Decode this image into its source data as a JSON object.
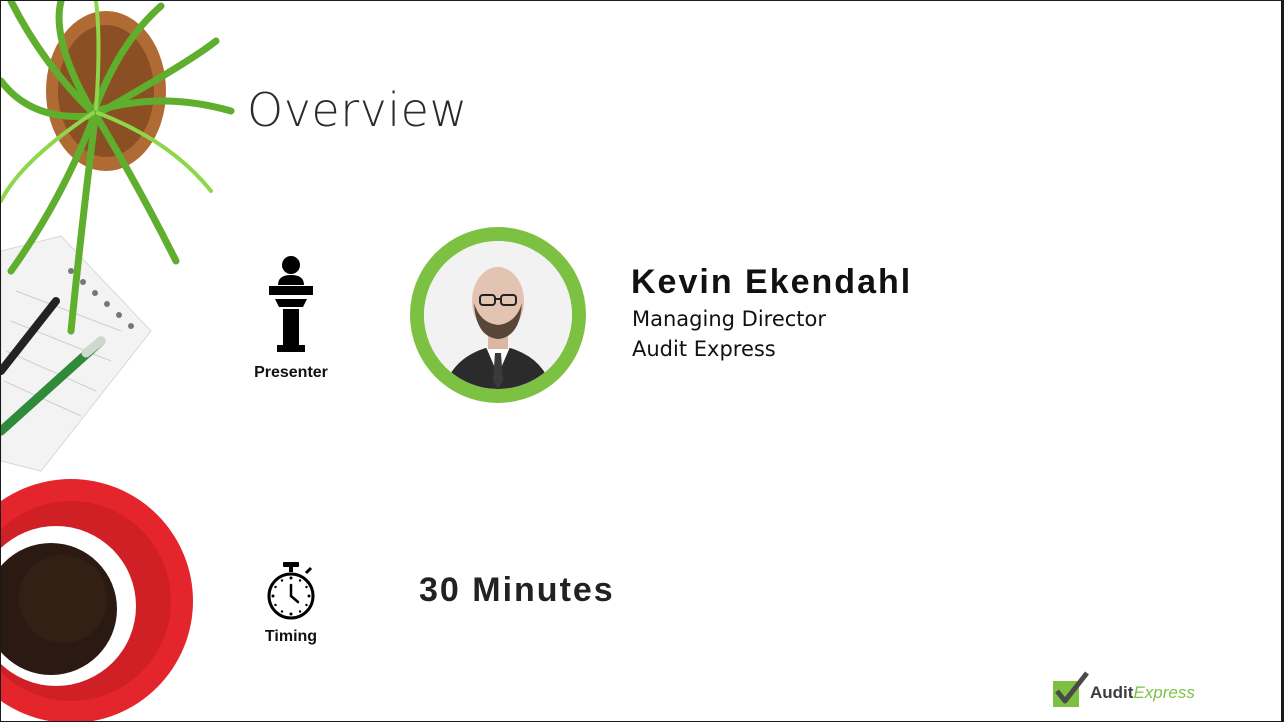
{
  "slide": {
    "title": "Overview"
  },
  "presenter": {
    "icon": "podium-icon",
    "icon_label": "Presenter",
    "name": "Kevin Ekendahl",
    "role": "Managing Director",
    "company": "Audit Express"
  },
  "timing": {
    "icon": "stopwatch-icon",
    "icon_label": "Timing",
    "duration": "30 Minutes"
  },
  "logo": {
    "brand_bold": "Audit",
    "brand_italic": "Express"
  },
  "colors": {
    "accent_green": "#7dc142",
    "cup_red": "#e4262c",
    "text_dark": "#111111"
  }
}
